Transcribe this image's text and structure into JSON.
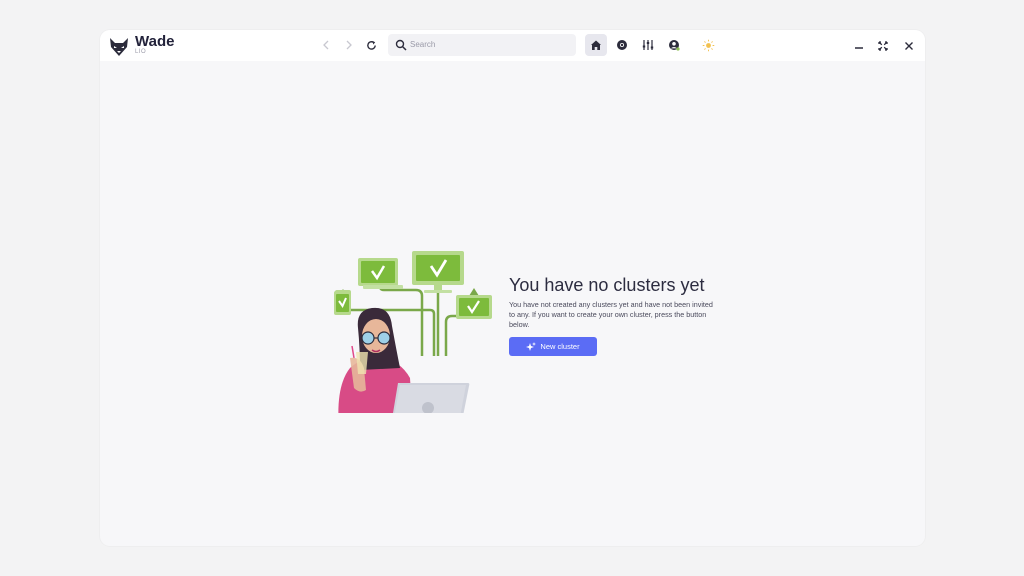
{
  "app": {
    "title": "Wade",
    "subtitle": "LIO"
  },
  "search": {
    "placeholder": "Search"
  },
  "toolbar": {
    "icons": [
      "home-icon",
      "chrome-icon",
      "sliders-icon",
      "account-icon",
      "sun-icon"
    ]
  },
  "window_controls": [
    "minimize-icon",
    "maximize-icon",
    "close-icon"
  ],
  "empty_state": {
    "title": "You have no clusters yet",
    "description": "You have not created any clusters yet and have not been invited to any. If you want to create your own cluster, press the button below.",
    "button_label": "New cluster"
  },
  "colors": {
    "accent": "#5b6cf5",
    "monitor_green": "#8dc153",
    "background": "#f7f7f9"
  }
}
